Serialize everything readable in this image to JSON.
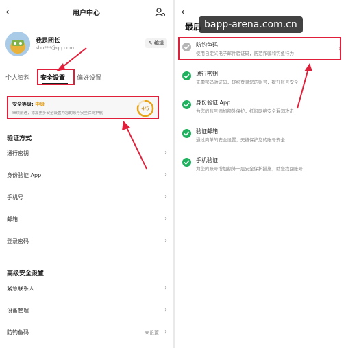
{
  "left": {
    "header": {
      "title": "用户中心"
    },
    "profile": {
      "username": "我是团长",
      "email": "shu***@qq.com",
      "edit_label": "编辑"
    },
    "tabs": [
      {
        "label": "个人资料"
      },
      {
        "label": "安全设置"
      },
      {
        "label": "偏好设置"
      }
    ],
    "security_level": {
      "label": "安全等级:",
      "value": "中级",
      "description": "继续前进，添加更多安全设置为您的账号安全保驾护航",
      "score": "4/5",
      "progress": 0.8
    },
    "verification": {
      "title": "验证方式",
      "items": [
        {
          "label": "通行密钥"
        },
        {
          "label": "身份验证 App"
        },
        {
          "label": "手机号"
        },
        {
          "label": "邮箱"
        },
        {
          "label": "登录密码"
        }
      ]
    },
    "advanced": {
      "title": "高级安全设置",
      "items": [
        {
          "label": "紧急联系人",
          "status": ""
        },
        {
          "label": "设备管理",
          "status": ""
        },
        {
          "label": "防钓鱼码",
          "status": "未设置"
        }
      ]
    }
  },
  "right": {
    "title": "最后",
    "watermark": "bapp-arena.com.cn",
    "items": [
      {
        "title": "防钓鱼码",
        "description": "使用自定义电子邮件验证码，防范诈骗和钓鱼行为",
        "status": "grey"
      },
      {
        "title": "通行密钥",
        "description": "无需密码验证码，轻松登录您的账号，提升账号安全",
        "status": "green"
      },
      {
        "title": "身份验证 App",
        "description": "为您的账号添加额外保护，抵御网络安全漏洞攻击",
        "status": "green"
      },
      {
        "title": "验证邮箱",
        "description": "通过简单的安全设置，无缝保护您的账号安全",
        "status": "green"
      },
      {
        "title": "手机验证",
        "description": "为您的账号增加额外一层安全保护措施，助您找回账号",
        "status": "green"
      }
    ]
  },
  "colors": {
    "highlight": "#e0203a",
    "accent_level": "#e6a21b",
    "check_green": "#20b15f"
  },
  "icons": {
    "back": "chevron-left-icon",
    "user_settings": "user-gear-icon",
    "edit": "pencil-icon",
    "chevron": "chevron-right-icon"
  }
}
